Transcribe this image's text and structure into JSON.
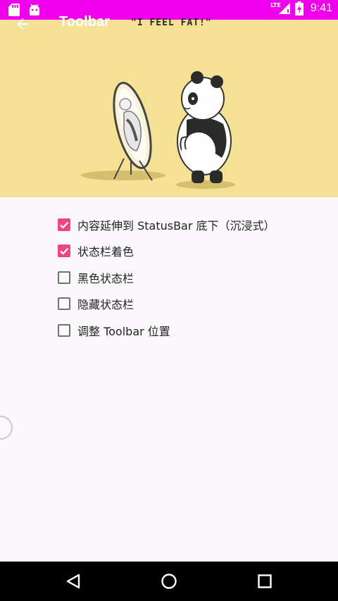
{
  "status_bar": {
    "time": "9:41",
    "network": "LTE",
    "icons": [
      "sd-card-icon",
      "android-icon",
      "signal-icon",
      "battery-charging-icon"
    ],
    "color": "#f000ec"
  },
  "toolbar": {
    "title": "Toolbar",
    "back_icon": "arrow-back-icon"
  },
  "header_image": {
    "caption": "\"I FEEL FAT!\"",
    "background": "#f4e193"
  },
  "options": [
    {
      "label": "内容延伸到 StatusBar 底下（沉浸式）",
      "checked": true
    },
    {
      "label": "状态栏着色",
      "checked": true
    },
    {
      "label": "黑色状态栏",
      "checked": false
    },
    {
      "label": "隐藏状态栏",
      "checked": false
    },
    {
      "label": "调整 Toolbar 位置",
      "checked": false
    }
  ],
  "accent_color": "#f0457d",
  "nav_bar": {
    "buttons": [
      "back-triangle-icon",
      "home-circle-icon",
      "recents-square-icon"
    ]
  }
}
